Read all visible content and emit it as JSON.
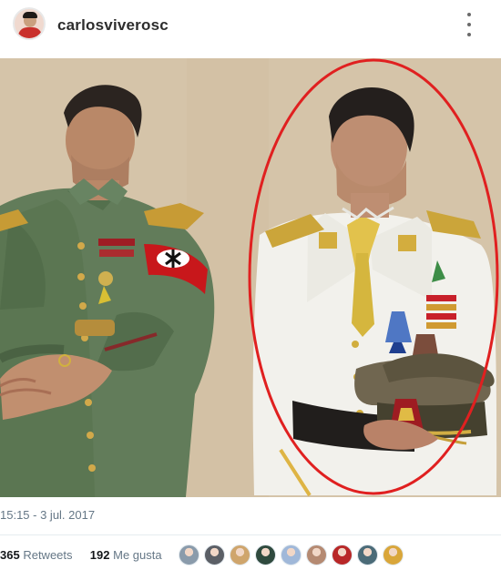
{
  "post": {
    "username": "carlosviverosc",
    "image_alt": ""
  },
  "tweet": {
    "timestamp": "15:15 - 3 jul. 2017",
    "retweets_count": "365",
    "retweets_label": "Retweets",
    "likes_count": "192",
    "likes_label": "Me gusta",
    "liker_avatar_colors": [
      "#8a9bab",
      "#5b5f66",
      "#cfa56c",
      "#2f4a3e",
      "#a0b8d9",
      "#b58a72",
      "#b82727",
      "#4b6b78",
      "#d9a63a"
    ]
  },
  "colors": {
    "highlight_circle": "#e02020",
    "background_wall": "#d8c7ad",
    "left_uniform": "#5f7a58",
    "right_uniform": "#f2f1ec",
    "armband": "#c8171b"
  }
}
